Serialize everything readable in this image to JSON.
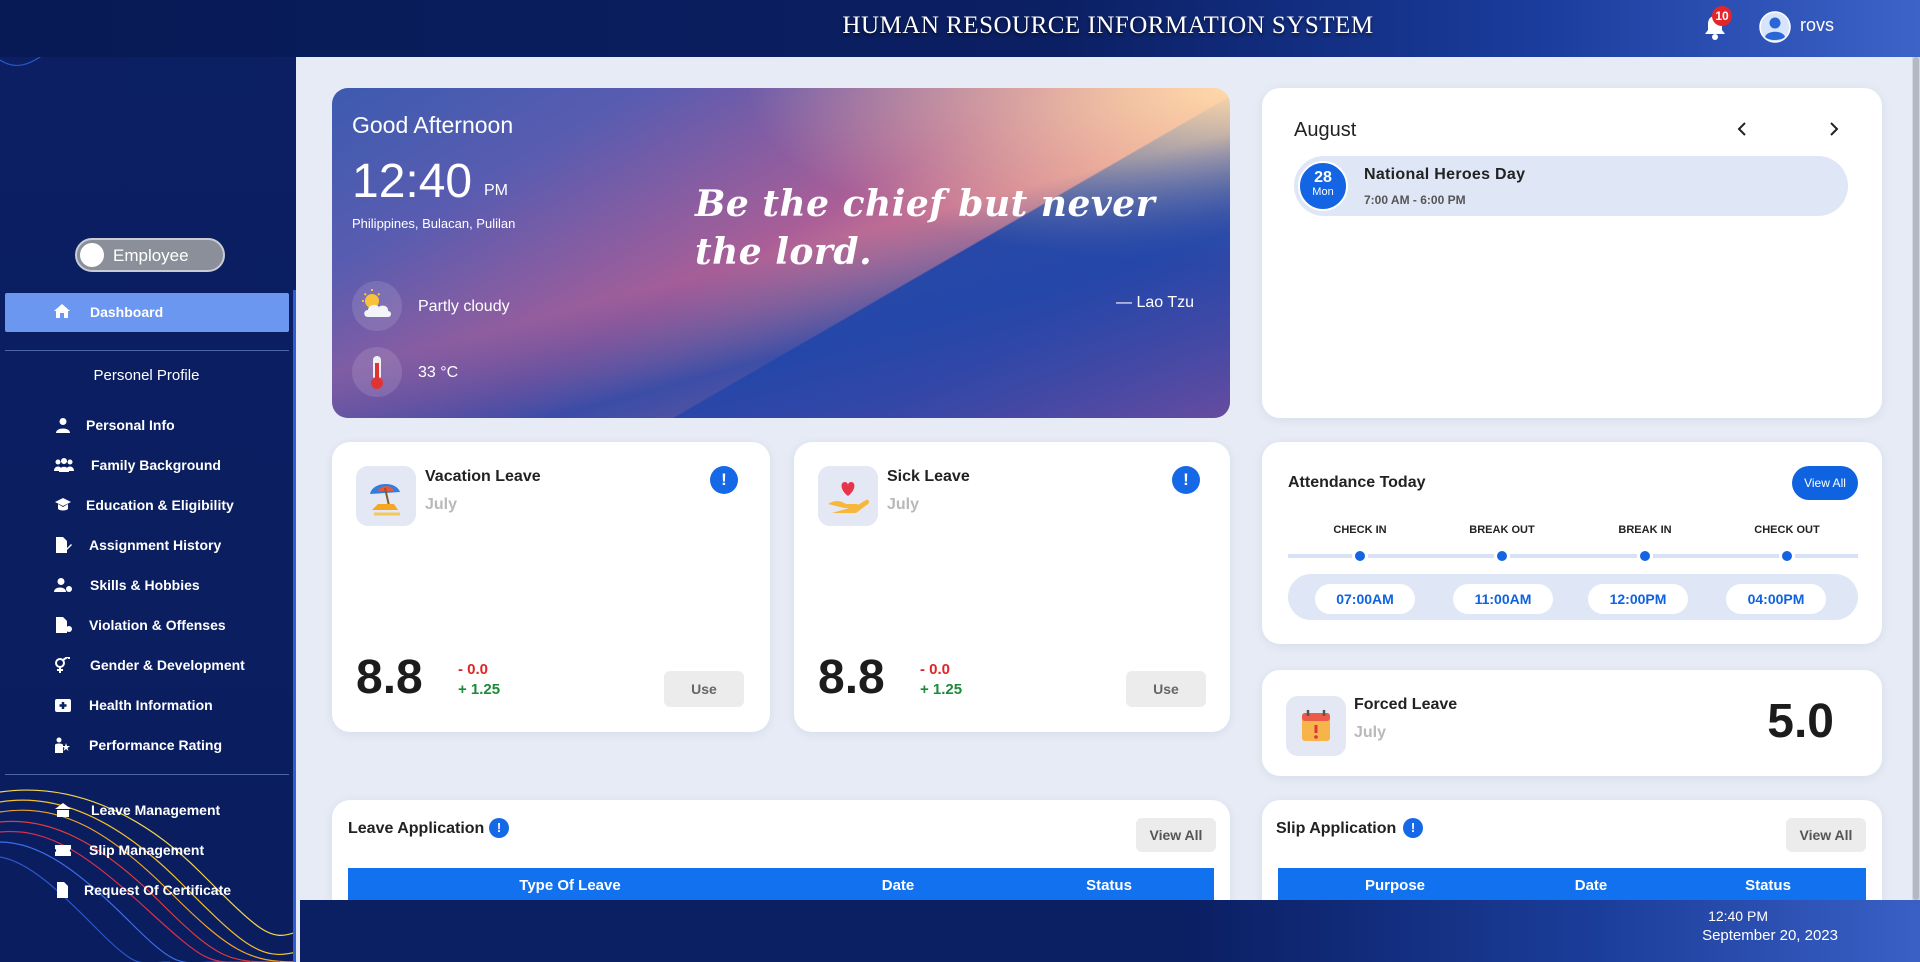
{
  "header": {
    "system_title": "HUMAN RESOURCE INFORMATION SYSTEM",
    "notification_count": "10",
    "user_name": "rovs"
  },
  "sidebar": {
    "role_toggle": "Employee",
    "dashboard": "Dashboard",
    "profile_section": "Personel Profile",
    "profile_items": [
      {
        "label": "Personal Info",
        "icon": "person-icon"
      },
      {
        "label": "Family Background",
        "icon": "family-icon"
      },
      {
        "label": "Education & Eligibility",
        "icon": "graduation-icon"
      },
      {
        "label": "Assignment History",
        "icon": "file-edit-icon"
      },
      {
        "label": "Skills & Hobbies",
        "icon": "user-gear-icon"
      },
      {
        "label": "Violation & Offenses",
        "icon": "file-alert-icon"
      },
      {
        "label": "Gender & Development",
        "icon": "gender-icon"
      },
      {
        "label": "Health Information",
        "icon": "medical-icon"
      },
      {
        "label": "Performance Rating",
        "icon": "rating-icon"
      }
    ],
    "management_items": [
      {
        "label": "Leave Management",
        "icon": "leave-icon"
      },
      {
        "label": "Slip Management",
        "icon": "ticket-icon"
      },
      {
        "label": "Request Of Certificate",
        "icon": "certificate-icon"
      }
    ]
  },
  "hero": {
    "greeting": "Good Afternoon",
    "time": "12:40",
    "ampm": "PM",
    "location": "Philippines, Bulacan, Pulilan",
    "weather": "Partly cloudy",
    "temperature": "33  °C",
    "quote": "Be the chief but never the lord.",
    "author": "— Lao Tzu"
  },
  "calendar": {
    "month": "August",
    "event": {
      "day": "28",
      "dow": "Mon",
      "name": "National Heroes Day",
      "time": "7:00 AM - 6:00 PM"
    }
  },
  "vacation_leave": {
    "title": "Vacation Leave",
    "month": "July",
    "balance": "8.8",
    "deduction": "- 0.0",
    "accrual": "+ 1.25",
    "use_label": "Use"
  },
  "sick_leave": {
    "title": "Sick Leave",
    "month": "July",
    "balance": "8.8",
    "deduction": "- 0.0",
    "accrual": "+ 1.25",
    "use_label": "Use"
  },
  "attendance": {
    "title": "Attendance Today",
    "view_all": "View All",
    "columns": [
      "CHECK IN",
      "BREAK OUT",
      "BREAK IN",
      "CHECK OUT"
    ],
    "times": [
      "07:00AM",
      "11:00AM",
      "12:00PM",
      "04:00PM"
    ]
  },
  "forced_leave": {
    "title": "Forced Leave",
    "month": "July",
    "value": "5.0"
  },
  "leave_application": {
    "title": "Leave Application",
    "view_all": "View All",
    "columns": [
      "Type Of Leave",
      "Date",
      "Status"
    ]
  },
  "slip_application": {
    "title": "Slip Application",
    "view_all": "View All",
    "columns": [
      "Purpose",
      "Date",
      "Status"
    ]
  },
  "footer": {
    "time": "12:40 PM",
    "date": "September 20, 2023"
  },
  "colors": {
    "navy": "#0b1f63",
    "accent_blue": "#1465e3",
    "active_nav": "#6b97f0",
    "negative": "#e02424",
    "positive": "#1b8a3a"
  }
}
